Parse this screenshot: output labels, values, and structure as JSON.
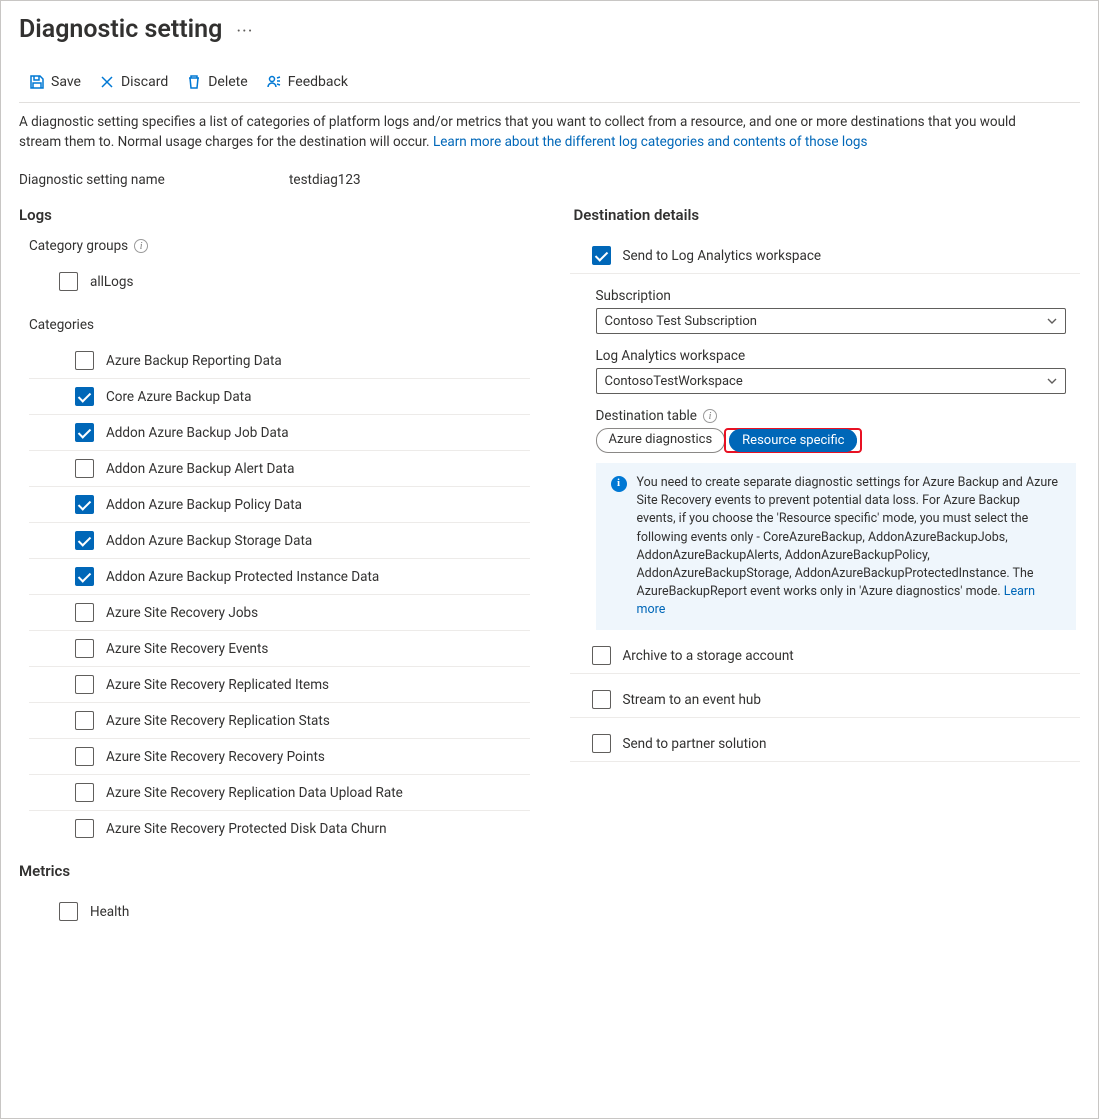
{
  "title": "Diagnostic setting",
  "toolbar": {
    "save": "Save",
    "discard": "Discard",
    "delete": "Delete",
    "feedback": "Feedback"
  },
  "description": {
    "text": "A diagnostic setting specifies a list of categories of platform logs and/or metrics that you want to collect from a resource, and one or more destinations that you would stream them to. Normal usage charges for the destination will occur. ",
    "link": "Learn more about the different log categories and contents of those logs"
  },
  "name": {
    "label": "Diagnostic setting name",
    "value": "testdiag123"
  },
  "logs": {
    "heading": "Logs",
    "category_groups_label": "Category groups",
    "groups": [
      {
        "label": "allLogs",
        "checked": false
      }
    ],
    "categories_label": "Categories",
    "categories": [
      {
        "label": "Azure Backup Reporting Data",
        "checked": false
      },
      {
        "label": "Core Azure Backup Data",
        "checked": true
      },
      {
        "label": "Addon Azure Backup Job Data",
        "checked": true
      },
      {
        "label": "Addon Azure Backup Alert Data",
        "checked": false
      },
      {
        "label": "Addon Azure Backup Policy Data",
        "checked": true
      },
      {
        "label": "Addon Azure Backup Storage Data",
        "checked": true
      },
      {
        "label": "Addon Azure Backup Protected Instance Data",
        "checked": true
      },
      {
        "label": "Azure Site Recovery Jobs",
        "checked": false
      },
      {
        "label": "Azure Site Recovery Events",
        "checked": false
      },
      {
        "label": "Azure Site Recovery Replicated Items",
        "checked": false
      },
      {
        "label": "Azure Site Recovery Replication Stats",
        "checked": false
      },
      {
        "label": "Azure Site Recovery Recovery Points",
        "checked": false
      },
      {
        "label": "Azure Site Recovery Replication Data Upload Rate",
        "checked": false
      },
      {
        "label": "Azure Site Recovery Protected Disk Data Churn",
        "checked": false
      }
    ]
  },
  "metrics": {
    "heading": "Metrics",
    "items": [
      {
        "label": "Health",
        "checked": false
      }
    ]
  },
  "destination": {
    "heading": "Destination details",
    "log_analytics": {
      "label": "Send to Log Analytics workspace",
      "checked": true,
      "subscription_label": "Subscription",
      "subscription_value": "Contoso Test Subscription",
      "workspace_label": "Log Analytics workspace",
      "workspace_value": "ContosoTestWorkspace",
      "dest_table_label": "Destination table",
      "pill_diag": "Azure diagnostics",
      "pill_res": "Resource specific",
      "info_text": "You need to create separate diagnostic settings for Azure Backup and Azure Site Recovery events to prevent potential data loss. For Azure Backup events, if you choose the 'Resource specific' mode, you must select the following events only - CoreAzureBackup, AddonAzureBackupJobs, AddonAzureBackupAlerts, AddonAzureBackupPolicy, AddonAzureBackupStorage, AddonAzureBackupProtectedInstance. The AzureBackupReport event works only in 'Azure diagnostics' mode.  ",
      "info_link": "Learn more"
    },
    "storage": {
      "label": "Archive to a storage account",
      "checked": false
    },
    "eventhub": {
      "label": "Stream to an event hub",
      "checked": false
    },
    "partner": {
      "label": "Send to partner solution",
      "checked": false
    }
  }
}
